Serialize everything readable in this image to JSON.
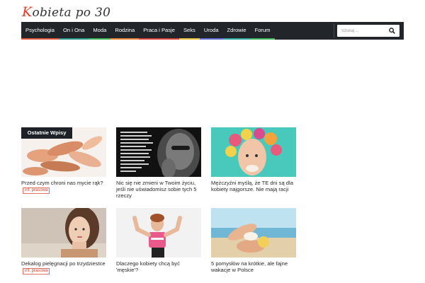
{
  "site": {
    "logo_k": "K",
    "logo_rest": "obieta po 30"
  },
  "nav": {
    "items": [
      {
        "label": "Psychologia",
        "color": "#e25a3f"
      },
      {
        "label": "On i Ona",
        "color": "#2c9a8a"
      },
      {
        "label": "Moda",
        "color": "#3fb45a"
      },
      {
        "label": "Rodzina",
        "color": "#e8843a"
      },
      {
        "label": "Praca i Pasje",
        "color": "#d8443c"
      },
      {
        "label": "Seks",
        "color": "#e9c23d"
      },
      {
        "label": "Uroda",
        "color": "#5f6ed0"
      },
      {
        "label": "Zdrowie",
        "color": "#2fa8a0"
      },
      {
        "label": "Forum",
        "color": "#22262b"
      }
    ],
    "search_placeholder": "Szukaj ..."
  },
  "section": {
    "label": "Ostatnie Wpisy"
  },
  "posts": [
    {
      "title": "Przed czym chroni nas mycie rąk?",
      "promo": "inf. prasowa"
    },
    {
      "title": "Nic się nie zmieni w Twoim życiu, jeśli nie uświadomisz sobie tych 5 rzeczy",
      "promo": ""
    },
    {
      "title": "Mężczyźni myślą, że TE dni są dla kobiety najgorsze. Nie mają racji",
      "promo": ""
    },
    {
      "title": "Dekalog pielęgnacji po trzydziestce",
      "promo": "inf. prasowa"
    },
    {
      "title": "Dlaczego kobiety chcą być 'męskie'?",
      "promo": ""
    },
    {
      "title": "5 pomysłów na krótkie, ale fajne wakacje w Polsce",
      "promo": ""
    }
  ],
  "colors": {
    "nav_bg": "#22262b",
    "promo": "#d04030"
  }
}
